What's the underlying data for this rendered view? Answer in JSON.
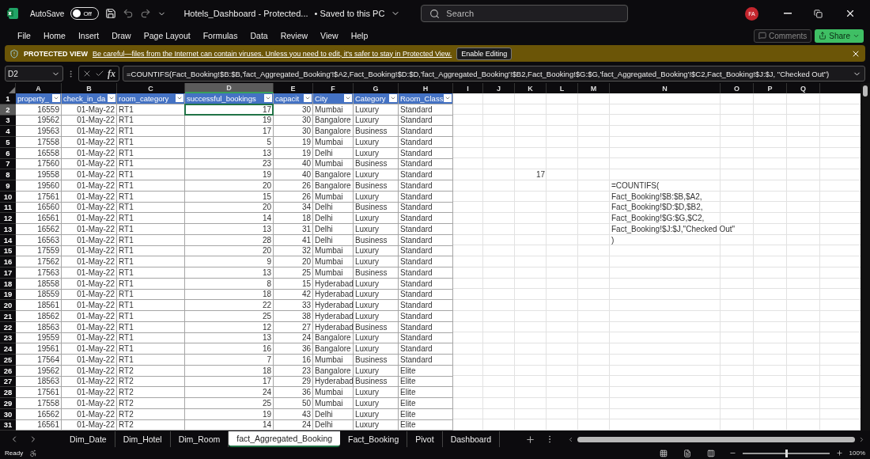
{
  "title_bar": {
    "autosave_label": "AutoSave",
    "autosave": {
      "on": false,
      "label": "Off"
    },
    "document_title": "Hotels_Dashboard  -  Protected...",
    "save_status": "• Saved to this PC",
    "search_placeholder": "Search",
    "avatar": "FA"
  },
  "ribbon_tabs": [
    "File",
    "Home",
    "Insert",
    "Draw",
    "Page Layout",
    "Formulas",
    "Data",
    "Review",
    "View",
    "Help"
  ],
  "ribbon_buttons": {
    "comments": "Comments",
    "share": "Share"
  },
  "protected_view": {
    "title": "PROTECTED VIEW",
    "message": "Be careful—files from the Internet can contain viruses. Unless you need to edit, it's safer to stay in Protected View.",
    "button": "Enable Editing"
  },
  "formula_bar": {
    "name_box": "D2",
    "fx": "fx",
    "formula": "=COUNTIFS(Fact_Booking!$B:$B,'fact_Aggregated_Booking'!$A2,Fact_Booking!$D:$D,'fact_Aggregated_Booking'!$B2,Fact_Booking!$G:$G,'fact_Aggregated_Booking'!$C2,Fact_Booking!$J:$J, \"Checked Out\")"
  },
  "sheet": {
    "columns": [
      {
        "label": "A",
        "selected": false,
        "kind": "number"
      },
      {
        "label": "B",
        "selected": false,
        "kind": "number"
      },
      {
        "label": "C",
        "selected": false,
        "kind": "text"
      },
      {
        "label": "D",
        "selected": true,
        "kind": "number"
      },
      {
        "label": "E",
        "selected": false,
        "kind": "number"
      },
      {
        "label": "F",
        "selected": false,
        "kind": "text"
      },
      {
        "label": "G",
        "selected": false,
        "kind": "text"
      },
      {
        "label": "H",
        "selected": false,
        "kind": "text"
      },
      {
        "label": "I",
        "selected": false,
        "kind": "text"
      },
      {
        "label": "J",
        "selected": false,
        "kind": "text"
      },
      {
        "label": "K",
        "selected": false,
        "kind": "number"
      },
      {
        "label": "L",
        "selected": false,
        "kind": "text"
      },
      {
        "label": "M",
        "selected": false,
        "kind": "text"
      },
      {
        "label": "N",
        "selected": false,
        "kind": "text"
      },
      {
        "label": "O",
        "selected": false,
        "kind": "text"
      },
      {
        "label": "P",
        "selected": false,
        "kind": "text"
      },
      {
        "label": "Q",
        "selected": false,
        "kind": "text"
      }
    ],
    "rows": [
      {
        "number": "1",
        "kind": "header",
        "selected": false,
        "values": [
          "property_",
          "check_in_da",
          "room_category",
          "successful_bookings",
          "capacit",
          "City",
          "Category",
          "Room_Class"
        ]
      },
      {
        "number": "2",
        "kind": "data",
        "selected": true,
        "values": [
          "16559",
          "01-May-22",
          "RT1",
          "17",
          "30",
          "Mumbai",
          "Luxury",
          "Standard"
        ]
      },
      {
        "number": "3",
        "kind": "data",
        "selected": false,
        "values": [
          "19562",
          "01-May-22",
          "RT1",
          "19",
          "30",
          "Bangalore",
          "Luxury",
          "Standard"
        ]
      },
      {
        "number": "4",
        "kind": "data",
        "selected": false,
        "values": [
          "19563",
          "01-May-22",
          "RT1",
          "17",
          "30",
          "Bangalore",
          "Business",
          "Standard"
        ]
      },
      {
        "number": "5",
        "kind": "data",
        "selected": false,
        "values": [
          "17558",
          "01-May-22",
          "RT1",
          "5",
          "19",
          "Mumbai",
          "Luxury",
          "Standard"
        ]
      },
      {
        "number": "6",
        "kind": "data",
        "selected": false,
        "values": [
          "16558",
          "01-May-22",
          "RT1",
          "13",
          "19",
          "Delhi",
          "Luxury",
          "Standard"
        ]
      },
      {
        "number": "7",
        "kind": "data",
        "selected": false,
        "values": [
          "17560",
          "01-May-22",
          "RT1",
          "23",
          "40",
          "Mumbai",
          "Business",
          "Standard"
        ]
      },
      {
        "number": "8",
        "kind": "data",
        "selected": false,
        "values": [
          "19558",
          "01-May-22",
          "RT1",
          "19",
          "40",
          "Bangalore",
          "Luxury",
          "Standard"
        ],
        "column_k": "17"
      },
      {
        "number": "9",
        "kind": "data",
        "selected": false,
        "values": [
          "19560",
          "01-May-22",
          "RT1",
          "20",
          "26",
          "Bangalore",
          "Business",
          "Standard"
        ],
        "column_n": "=COUNTIFS("
      },
      {
        "number": "10",
        "kind": "data",
        "selected": false,
        "values": [
          "17561",
          "01-May-22",
          "RT1",
          "15",
          "26",
          "Mumbai",
          "Luxury",
          "Standard"
        ],
        "column_n": "Fact_Booking!$B:$B,$A2,"
      },
      {
        "number": "11",
        "kind": "data",
        "selected": false,
        "values": [
          "16560",
          "01-May-22",
          "RT1",
          "20",
          "34",
          "Delhi",
          "Business",
          "Standard"
        ],
        "column_n": "Fact_Booking!$D:$D,$B2,"
      },
      {
        "number": "12",
        "kind": "data",
        "selected": false,
        "values": [
          "16561",
          "01-May-22",
          "RT1",
          "14",
          "18",
          "Delhi",
          "Luxury",
          "Standard"
        ],
        "column_n": "Fact_Booking!$G:$G,$C2,"
      },
      {
        "number": "13",
        "kind": "data",
        "selected": false,
        "values": [
          "16562",
          "01-May-22",
          "RT1",
          "13",
          "31",
          "Delhi",
          "Luxury",
          "Standard"
        ],
        "column_n": "Fact_Booking!$J:$J,\"Checked Out\""
      },
      {
        "number": "14",
        "kind": "data",
        "selected": false,
        "values": [
          "16563",
          "01-May-22",
          "RT1",
          "28",
          "41",
          "Delhi",
          "Business",
          "Standard"
        ],
        "column_n": ")"
      },
      {
        "number": "15",
        "kind": "data",
        "selected": false,
        "values": [
          "17559",
          "01-May-22",
          "RT1",
          "20",
          "32",
          "Mumbai",
          "Luxury",
          "Standard"
        ]
      },
      {
        "number": "16",
        "kind": "data",
        "selected": false,
        "values": [
          "17562",
          "01-May-22",
          "RT1",
          "9",
          "20",
          "Mumbai",
          "Luxury",
          "Standard"
        ]
      },
      {
        "number": "17",
        "kind": "data",
        "selected": false,
        "values": [
          "17563",
          "01-May-22",
          "RT1",
          "13",
          "25",
          "Mumbai",
          "Business",
          "Standard"
        ]
      },
      {
        "number": "18",
        "kind": "data",
        "selected": false,
        "values": [
          "18558",
          "01-May-22",
          "RT1",
          "8",
          "15",
          "Hyderabad",
          "Luxury",
          "Standard"
        ]
      },
      {
        "number": "19",
        "kind": "data",
        "selected": false,
        "values": [
          "18559",
          "01-May-22",
          "RT1",
          "18",
          "42",
          "Hyderabad",
          "Luxury",
          "Standard"
        ]
      },
      {
        "number": "20",
        "kind": "data",
        "selected": false,
        "values": [
          "18561",
          "01-May-22",
          "RT1",
          "22",
          "33",
          "Hyderabad",
          "Luxury",
          "Standard"
        ]
      },
      {
        "number": "21",
        "kind": "data",
        "selected": false,
        "values": [
          "18562",
          "01-May-22",
          "RT1",
          "25",
          "38",
          "Hyderabad",
          "Luxury",
          "Standard"
        ]
      },
      {
        "number": "22",
        "kind": "data",
        "selected": false,
        "values": [
          "18563",
          "01-May-22",
          "RT1",
          "12",
          "27",
          "Hyderabad",
          "Business",
          "Standard"
        ]
      },
      {
        "number": "23",
        "kind": "data",
        "selected": false,
        "values": [
          "19559",
          "01-May-22",
          "RT1",
          "13",
          "24",
          "Bangalore",
          "Luxury",
          "Standard"
        ]
      },
      {
        "number": "24",
        "kind": "data",
        "selected": false,
        "values": [
          "19561",
          "01-May-22",
          "RT1",
          "16",
          "36",
          "Bangalore",
          "Luxury",
          "Standard"
        ]
      },
      {
        "number": "25",
        "kind": "data",
        "selected": false,
        "values": [
          "17564",
          "01-May-22",
          "RT1",
          "7",
          "16",
          "Mumbai",
          "Business",
          "Standard"
        ]
      },
      {
        "number": "26",
        "kind": "data",
        "selected": false,
        "values": [
          "19562",
          "01-May-22",
          "RT2",
          "18",
          "23",
          "Bangalore",
          "Luxury",
          "Elite"
        ]
      },
      {
        "number": "27",
        "kind": "data",
        "selected": false,
        "values": [
          "18563",
          "01-May-22",
          "RT2",
          "17",
          "29",
          "Hyderabad",
          "Business",
          "Elite"
        ]
      },
      {
        "number": "28",
        "kind": "data",
        "selected": false,
        "values": [
          "17561",
          "01-May-22",
          "RT2",
          "24",
          "36",
          "Mumbai",
          "Luxury",
          "Elite"
        ]
      },
      {
        "number": "29",
        "kind": "data",
        "selected": false,
        "values": [
          "17558",
          "01-May-22",
          "RT2",
          "25",
          "50",
          "Mumbai",
          "Luxury",
          "Elite"
        ]
      },
      {
        "number": "30",
        "kind": "data",
        "selected": false,
        "values": [
          "16562",
          "01-May-22",
          "RT2",
          "19",
          "43",
          "Delhi",
          "Luxury",
          "Elite"
        ]
      },
      {
        "number": "31",
        "kind": "data",
        "selected": false,
        "values": [
          "16561",
          "01-May-22",
          "RT2",
          "14",
          "24",
          "Delhi",
          "Luxury",
          "Elite"
        ]
      }
    ]
  },
  "sheet_tabs": [
    {
      "label": "Dim_Date",
      "selected": false
    },
    {
      "label": "Dim_Hotel",
      "selected": false
    },
    {
      "label": "Dim_Room",
      "selected": false
    },
    {
      "label": "fact_Aggregated_Booking",
      "selected": true
    },
    {
      "label": "Fact_Booking",
      "selected": false
    },
    {
      "label": "Pivot",
      "selected": false
    },
    {
      "label": "Dashboard",
      "selected": false
    }
  ],
  "status_bar": {
    "status": "Ready",
    "zoom": {
      "level": 0.5,
      "reading": "100%"
    }
  }
}
